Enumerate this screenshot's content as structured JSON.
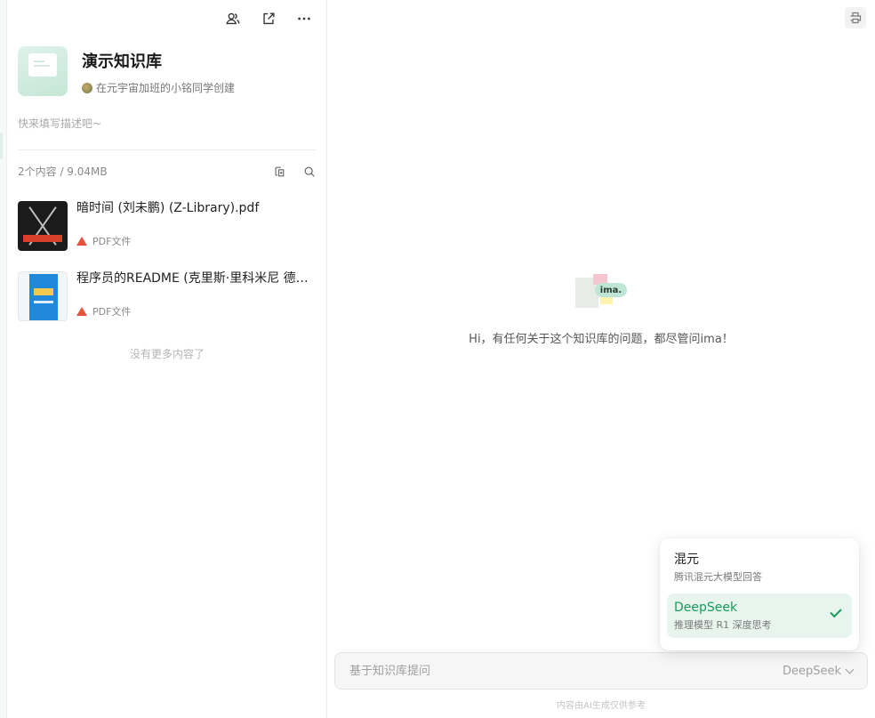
{
  "knowledge_base": {
    "title": "演示知识库",
    "owner": "在元宇宙加班的小铭同学创建",
    "description_placeholder": "快来填写描述吧~",
    "content_count": "2个内容 / 9.04MB"
  },
  "documents": [
    {
      "name": "暗时间 (刘未鹏) (Z-Library).pdf",
      "type": "PDF文件"
    },
    {
      "name": "程序员的README (克里斯·里科米尼 德米…",
      "type": "PDF文件"
    }
  ],
  "no_more_text": "没有更多内容了",
  "chat": {
    "logo_text": "ima.",
    "greeting": "Hi，有任何关于这个知识库的问题，都尽管问ima！",
    "input_placeholder": "基于知识库提问",
    "selected_model": "DeepSeek",
    "footer_note": "内容由AI生成仅供参考"
  },
  "model_menu": [
    {
      "name": "混元",
      "desc": "腾讯混元大模型回答",
      "selected": false
    },
    {
      "name": "DeepSeek",
      "desc": "推理模型 R1 深度思考",
      "selected": true
    }
  ],
  "icons": {
    "top": [
      "members-icon",
      "share-icon",
      "more-icon"
    ],
    "count_row": [
      "add-content-icon",
      "search-icon"
    ],
    "right_top": "print-icon"
  },
  "colors": {
    "accent": "#1a9a5a",
    "selected_bg": "#e8f5ee",
    "pdf": "#e5533c"
  }
}
